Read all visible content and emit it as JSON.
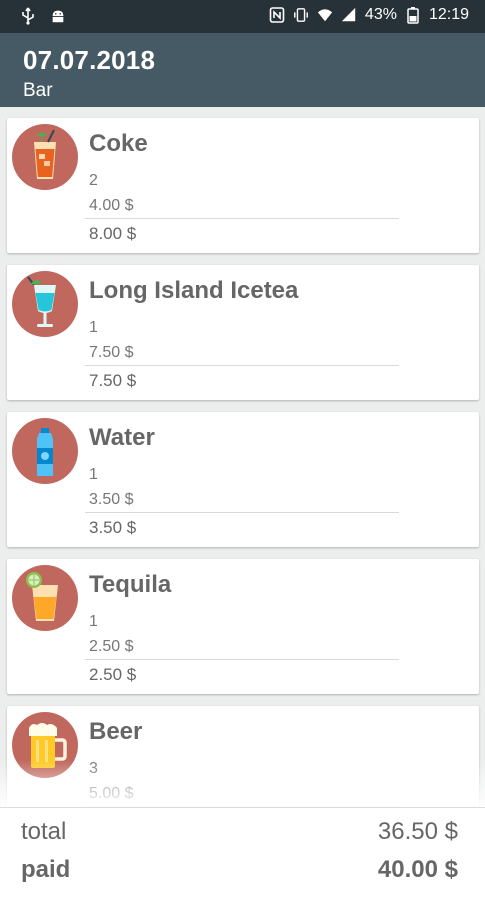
{
  "status_bar": {
    "battery": "43%",
    "time": "12:19",
    "left_icons": [
      "usb-icon",
      "android-icon"
    ],
    "right_icons": [
      "nfc-icon",
      "vibrate-icon",
      "wifi-icon",
      "signal-icon",
      "battery-icon"
    ]
  },
  "header": {
    "title": "07.07.2018",
    "subtitle": "Bar"
  },
  "items": [
    {
      "name": "Coke",
      "quantity": "2",
      "price": "4.00 $",
      "total": "8.00 $",
      "icon": "cola-glass-icon"
    },
    {
      "name": "Long Island Icetea",
      "quantity": "1",
      "price": "7.50 $",
      "total": "7.50 $",
      "icon": "cocktail-glass-icon"
    },
    {
      "name": "Water",
      "quantity": "1",
      "price": "3.50 $",
      "total": "3.50 $",
      "icon": "water-bottle-icon"
    },
    {
      "name": "Tequila",
      "quantity": "1",
      "price": "2.50 $",
      "total": "2.50 $",
      "icon": "tequila-shot-icon"
    },
    {
      "name": "Beer",
      "quantity": "3",
      "price": "5.00 $",
      "total": "",
      "icon": "beer-mug-icon"
    }
  ],
  "footer": {
    "total_label": "total",
    "total_value": "36.50 $",
    "paid_label": "paid",
    "paid_value": "40.00 $"
  },
  "colors": {
    "status_bar": "#263238",
    "app_bar": "#455a64",
    "icon_circle": "#c0685d",
    "background": "#eceeee"
  }
}
